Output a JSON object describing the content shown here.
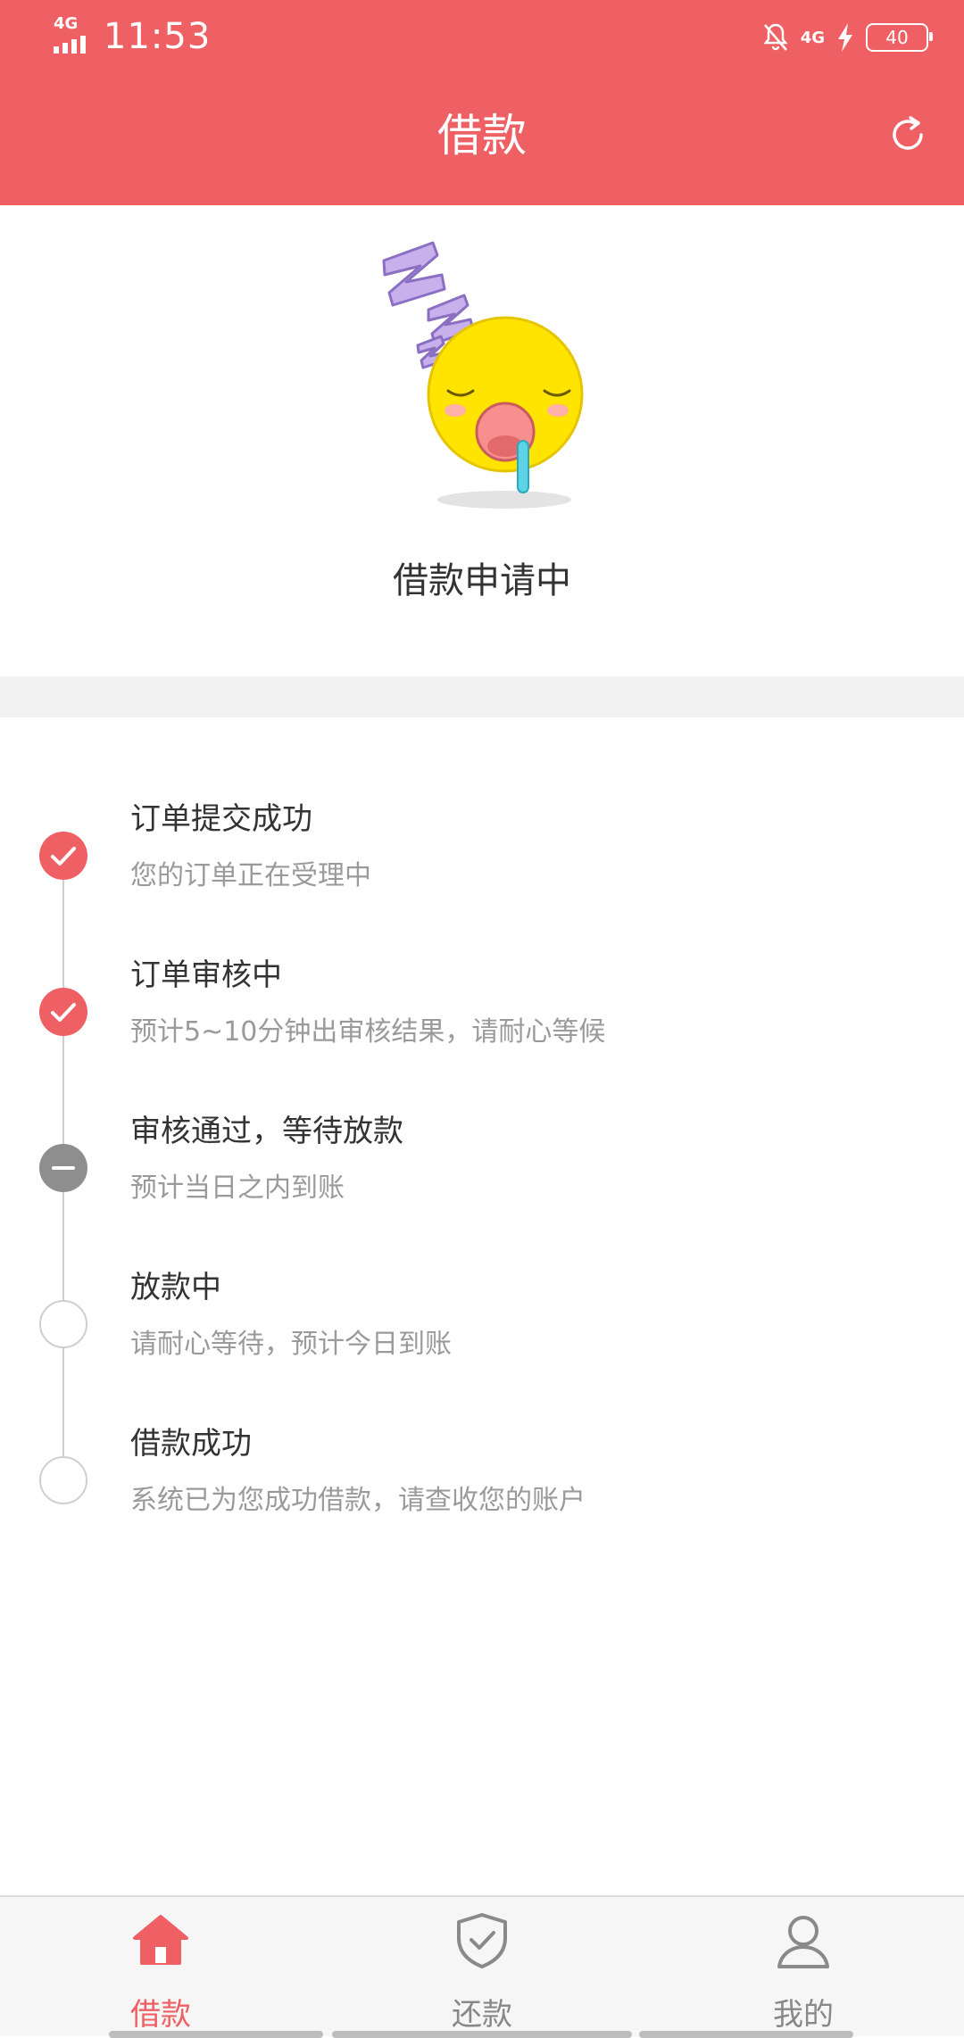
{
  "status_bar": {
    "time": "11:53",
    "network_left": "4G",
    "network_right": "4G",
    "battery": "40"
  },
  "header": {
    "title": "借款",
    "refresh_icon": "refresh-icon"
  },
  "application": {
    "status": "借款申请中",
    "illustration": "sleeping-face-illustration"
  },
  "steps": [
    {
      "title": "订单提交成功",
      "desc": "您的订单正在受理中",
      "state": "done"
    },
    {
      "title": "订单审核中",
      "desc": "预计5~10分钟出审核结果，请耐心等候",
      "state": "done"
    },
    {
      "title": "审核通过，等待放款",
      "desc": "预计当日之内到账",
      "state": "current"
    },
    {
      "title": "放款中",
      "desc": "请耐心等待，预计今日到账",
      "state": "pending"
    },
    {
      "title": "借款成功",
      "desc": "系统已为您成功借款，请查收您的账户",
      "state": "pending"
    }
  ],
  "bottom_nav": {
    "tabs": [
      {
        "label": "借款",
        "icon": "home-icon",
        "active": true
      },
      {
        "label": "还款",
        "icon": "shield-check-icon",
        "active": false
      },
      {
        "label": "我的",
        "icon": "user-icon",
        "active": false
      }
    ]
  },
  "colors": {
    "accent": "#ef6064",
    "current_step": "#8e8e8e",
    "text_primary": "#333333",
    "text_secondary": "#9a9a9a"
  }
}
